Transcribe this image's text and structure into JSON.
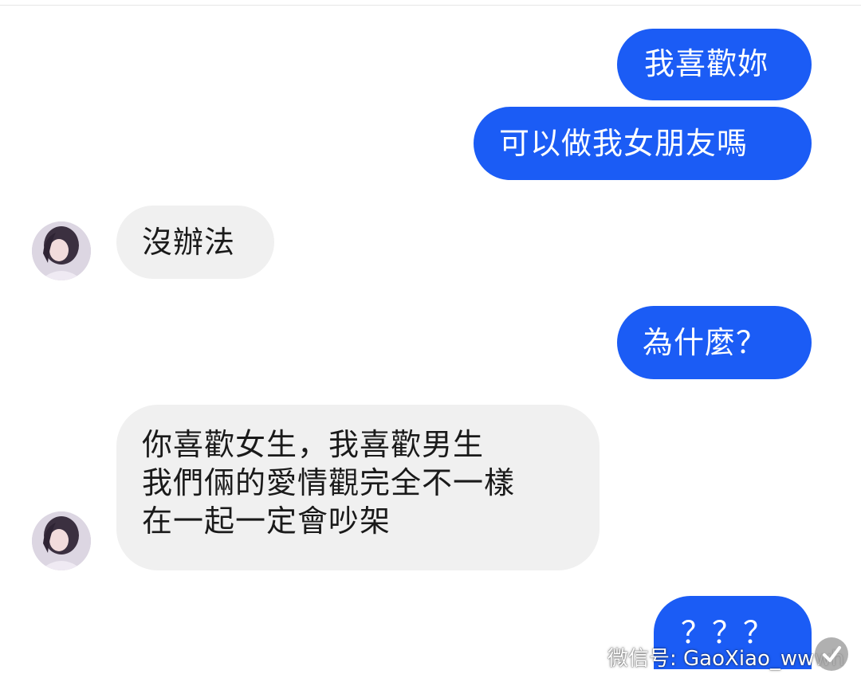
{
  "conversation": {
    "messages": [
      {
        "side": "sent",
        "text": "我喜歡妳"
      },
      {
        "side": "sent",
        "text": "可以做我女朋友嗎"
      },
      {
        "side": "received",
        "text": "沒辦法"
      },
      {
        "side": "sent",
        "text": "為什麼？"
      },
      {
        "side": "received",
        "text": "你喜歡女生，我喜歡男生\n我們倆的愛情觀完全不一樣\n在一起一定會吵架"
      },
      {
        "side": "sent",
        "text": "？？？"
      }
    ]
  },
  "watermark": {
    "text": "微信号: GaoXiao_wwwh",
    "icon": "wechat-icon"
  },
  "colors": {
    "sent_bubble": "#1b5cf5",
    "received_bubble": "#f0f0f0",
    "background": "#ffffff"
  }
}
